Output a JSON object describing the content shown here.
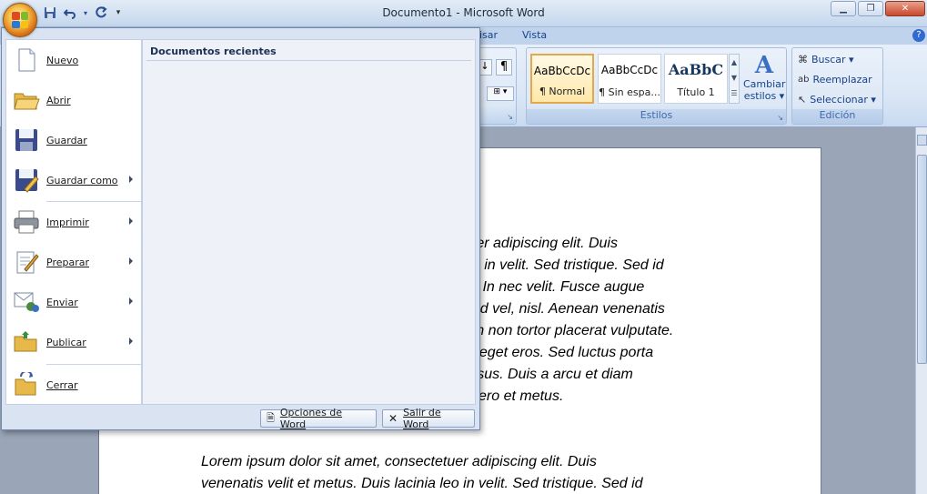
{
  "window": {
    "title": "Documento1 - Microsoft Word"
  },
  "quick_access": [
    {
      "name": "save-icon",
      "glyph": "💾"
    },
    {
      "name": "undo-icon",
      "glyph": "↶"
    },
    {
      "name": "redo-icon",
      "glyph": "↻"
    }
  ],
  "tabs": {
    "revisar_partial": "isar",
    "vista": "Vista"
  },
  "ribbon": {
    "styles": {
      "label": "Estilos",
      "items": [
        {
          "sample": "AaBbCcDc",
          "name": "¶ Normal"
        },
        {
          "sample": "AaBbCcDc",
          "name": "¶ Sin espa..."
        },
        {
          "sample": "AaBbC",
          "name": "Título 1"
        }
      ],
      "change_styles": [
        "Cambiar",
        "estilos ▾"
      ]
    },
    "editing": {
      "label": "Edición",
      "buscar": "Buscar ▾",
      "reemplazar": "Reemplazar",
      "seleccionar": "Seleccionar ▾"
    }
  },
  "office_menu": {
    "recent_title": "Documentos recientes",
    "items": [
      {
        "label": "Nuevo",
        "icon": "new-document-icon",
        "arrow": false
      },
      {
        "label": "Abrir",
        "icon": "open-folder-icon",
        "arrow": false
      },
      {
        "label": "Guardar",
        "icon": "save-icon",
        "arrow": false
      },
      {
        "label": "Guardar como",
        "icon": "save-as-icon",
        "arrow": true
      },
      {
        "label": "Imprimir",
        "icon": "printer-icon",
        "arrow": true
      },
      {
        "label": "Preparar",
        "icon": "prepare-icon",
        "arrow": true
      },
      {
        "label": "Enviar",
        "icon": "send-icon",
        "arrow": true
      },
      {
        "label": "Publicar",
        "icon": "publish-icon",
        "arrow": true
      },
      {
        "label": "Cerrar",
        "icon": "close-folder-icon",
        "arrow": false
      }
    ],
    "options_button": "Opciones de Word",
    "exit_button": "Salir de Word"
  },
  "document": {
    "visible_fragment_lines": [
      "tuer adipiscing elit. Duis",
      "eo in velit. Sed tristique. Sed id",
      "is. In nec velit. Fusce augue",
      "nod vel, nisl. Aenean venenatis",
      "em non tortor placerat vulputate.",
      "bi eget eros. Sed luctus porta",
      "ursus. Duis a arcu et diam",
      "libero et metus."
    ],
    "paragraph2_lines": [
      "Lorem ipsum dolor sit amet, consectetuer adipiscing elit. Duis",
      "venenatis velit et metus. Duis lacinia leo in velit. Sed tristique. Sed id"
    ]
  }
}
